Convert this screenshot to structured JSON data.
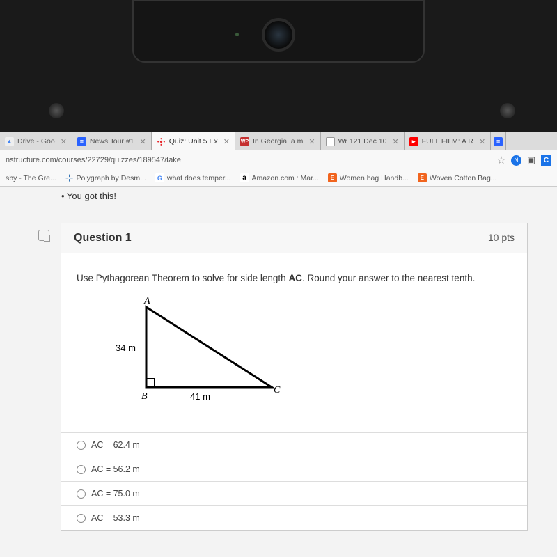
{
  "browser": {
    "url": "nstructure.com/courses/22729/quizzes/189547/take",
    "tabs": [
      {
        "label": "Drive - Goo",
        "fav": "drive"
      },
      {
        "label": "NewsHour #1",
        "fav": "doc"
      },
      {
        "label": "Quiz: Unit 5 Ex",
        "fav": "canvas",
        "active": true
      },
      {
        "label": "In Georgia, a m",
        "fav": "news"
      },
      {
        "label": "Wr 121 Dec 10",
        "fav": "wr"
      },
      {
        "label": "FULL FILM: A R",
        "fav": "yt"
      }
    ],
    "bookmarks": [
      {
        "label": "sby - The Gre...",
        "fav": ""
      },
      {
        "label": "Polygraph by Desm...",
        "fav": "desmos"
      },
      {
        "label": "what does temper...",
        "fav": "g"
      },
      {
        "label": "Amazon.com : Mar...",
        "fav": "amz"
      },
      {
        "label": "Women bag Handb...",
        "fav": "etsy"
      },
      {
        "label": "Woven Cotton Bag...",
        "fav": "etsy"
      }
    ]
  },
  "page": {
    "encouragement": "You got this!"
  },
  "question": {
    "number_label": "Question 1",
    "points_label": "10 pts",
    "prompt_pre": "Use Pythagorean Theorem to solve for side length ",
    "prompt_bold": "AC",
    "prompt_post": ". Round your answer to the nearest tenth.",
    "diagram": {
      "vertex_top": "A",
      "vertex_bl": "B",
      "vertex_br": "C",
      "side_ab": "34 m",
      "side_bc": "41 m"
    },
    "options": [
      {
        "text": "AC = 62.4 m"
      },
      {
        "text": "AC = 56.2 m"
      },
      {
        "text": "AC = 75.0 m"
      },
      {
        "text": "AC = 53.3 m"
      }
    ]
  }
}
